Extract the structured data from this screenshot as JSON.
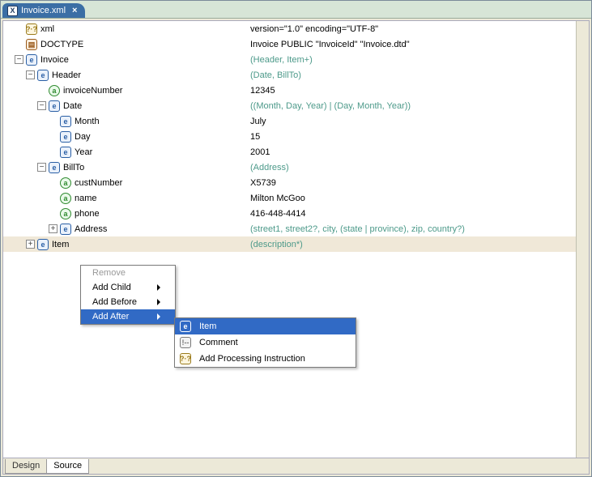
{
  "tab": {
    "title": "Invoice.xml",
    "close_glyph": "×",
    "icon_letter": "X"
  },
  "rows": [
    {
      "indent": 0,
      "exp": "",
      "icon": "pi",
      "iconText": "?·?",
      "label": "xml",
      "value": "version=\"1.0\" encoding=\"UTF-8\"",
      "hint": false
    },
    {
      "indent": 0,
      "exp": "",
      "icon": "dt",
      "iconText": "▤",
      "label": "DOCTYPE",
      "value": "Invoice PUBLIC \"InvoiceId\" \"Invoice.dtd\"",
      "hint": false
    },
    {
      "indent": 0,
      "exp": "-",
      "icon": "e",
      "iconText": "e",
      "label": "Invoice",
      "value": "(Header, Item+)",
      "hint": true
    },
    {
      "indent": 1,
      "exp": "-",
      "icon": "e",
      "iconText": "e",
      "label": "Header",
      "value": "(Date, BillTo)",
      "hint": true
    },
    {
      "indent": 2,
      "exp": "",
      "icon": "a",
      "iconText": "a",
      "label": "invoiceNumber",
      "value": "12345",
      "hint": false
    },
    {
      "indent": 2,
      "exp": "-",
      "icon": "e",
      "iconText": "e",
      "label": "Date",
      "value": "((Month, Day, Year) | (Day, Month, Year))",
      "hint": true
    },
    {
      "indent": 3,
      "exp": "",
      "icon": "e",
      "iconText": "e",
      "label": "Month",
      "value": "July",
      "hint": false
    },
    {
      "indent": 3,
      "exp": "",
      "icon": "e",
      "iconText": "e",
      "label": "Day",
      "value": "15",
      "hint": false
    },
    {
      "indent": 3,
      "exp": "",
      "icon": "e",
      "iconText": "e",
      "label": "Year",
      "value": "2001",
      "hint": false
    },
    {
      "indent": 2,
      "exp": "-",
      "icon": "e",
      "iconText": "e",
      "label": "BillTo",
      "value": "(Address)",
      "hint": true
    },
    {
      "indent": 3,
      "exp": "",
      "icon": "a",
      "iconText": "a",
      "label": "custNumber",
      "value": "X5739",
      "hint": false
    },
    {
      "indent": 3,
      "exp": "",
      "icon": "a",
      "iconText": "a",
      "label": "name",
      "value": "Milton McGoo",
      "hint": false
    },
    {
      "indent": 3,
      "exp": "",
      "icon": "a",
      "iconText": "a",
      "label": "phone",
      "value": "416-448-4414",
      "hint": false
    },
    {
      "indent": 3,
      "exp": "+",
      "icon": "e",
      "iconText": "e",
      "label": "Address",
      "value": "(street1, street2?, city, (state | province), zip, country?)",
      "hint": true
    },
    {
      "indent": 1,
      "exp": "+",
      "icon": "e",
      "iconText": "e",
      "label": "Item",
      "value": "(description*)",
      "hint": true,
      "selected": true
    }
  ],
  "context_menu": {
    "items": [
      {
        "label": "Remove",
        "disabled": true,
        "submenu": false
      },
      {
        "label": "Add Child",
        "disabled": false,
        "submenu": true
      },
      {
        "label": "Add Before",
        "disabled": false,
        "submenu": true
      },
      {
        "label": "Add After",
        "disabled": false,
        "submenu": true,
        "highlighted": true
      }
    ]
  },
  "submenu": {
    "items": [
      {
        "icon": "e",
        "iconText": "e",
        "label": "Item",
        "highlighted": true
      },
      {
        "icon": "c",
        "iconText": "!--",
        "label": "Comment",
        "highlighted": false
      },
      {
        "icon": "pi",
        "iconText": "?·?",
        "label": "Add Processing Instruction",
        "highlighted": false
      }
    ]
  },
  "bottom_tabs": {
    "design": "Design",
    "source": "Source"
  }
}
